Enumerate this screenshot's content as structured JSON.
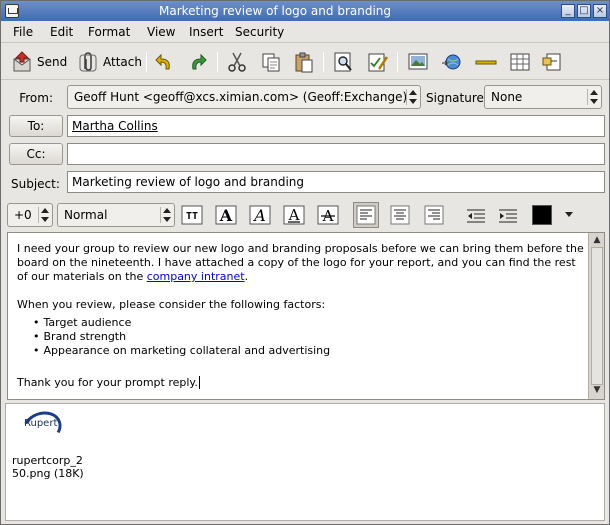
{
  "window": {
    "title": "Marketing review of logo and branding"
  },
  "menu": [
    {
      "label": "File",
      "mnemonic": "F"
    },
    {
      "label": "Edit",
      "mnemonic": "E"
    },
    {
      "label": "Format",
      "mnemonic": "m"
    },
    {
      "label": "View",
      "mnemonic": "V"
    },
    {
      "label": "Insert",
      "mnemonic": "I"
    },
    {
      "label": "Security",
      "mnemonic": "S"
    }
  ],
  "toolbar": {
    "send_label": "Send",
    "attach_label": "Attach"
  },
  "header": {
    "from_label": "From:",
    "from_value": "Geoff Hunt <geoff@xcs.ximian.com> (Geoff:Exchange)",
    "signature_label": "Signature:",
    "signature_value": "None",
    "to_button": "To:",
    "to_value": "Martha Collins",
    "cc_button": "Cc:",
    "cc_value": "",
    "subject_label": "Subject:",
    "subject_value": "Marketing review of logo and branding"
  },
  "format": {
    "size_value": "+0",
    "style_value": "Normal",
    "text_color": "#000000"
  },
  "body": {
    "para1_start": "I need your group to review our new logo and branding proposals before we can bring them before the board on the nineteenth.  I have attached a copy of the logo for your report, and you can find the rest of our materials on the ",
    "link_text": "company intranet",
    "para1_end": ".",
    "para2": "When you review, please consider the following factors:",
    "bullets": [
      "Target audience",
      "Brand strength",
      "Appearance on marketing collateral and advertising"
    ],
    "para3": "Thank you for your prompt reply."
  },
  "attachment": {
    "logo_text": "Rupert",
    "filename_line1": "rupertcorp_2",
    "filename_line2": "50.png (18K)"
  },
  "colors": {
    "titlebar": "#3f6cb4",
    "link": "#0000ee"
  }
}
